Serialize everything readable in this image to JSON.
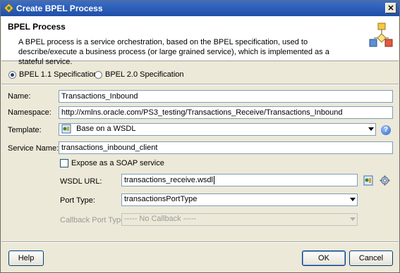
{
  "window": {
    "title": "Create BPEL Process",
    "close_glyph": "✕"
  },
  "header": {
    "title": "BPEL Process",
    "description": "A BPEL process is a service orchestration, based on the BPEL specification, used to describe/execute a business process (or large grained service), which is implemented as a stateful service."
  },
  "spec": {
    "option1": "BPEL 1.1 Specification",
    "option2": "BPEL 2.0 Specification",
    "selected": "BPEL 1.1 Specification"
  },
  "form": {
    "name_label": "Name:",
    "name_value": "Transactions_Inbound",
    "namespace_label": "Namespace:",
    "namespace_value": "http://xmlns.oracle.com/PS3_testing/Transactions_Receive/Transactions_Inbound",
    "template_label": "Template:",
    "template_value": "Base on a WSDL",
    "service_name_label": "Service Name:",
    "service_name_value": "transactions_inbound_client",
    "expose_soap_label": "Expose as a SOAP service",
    "expose_soap_checked": false,
    "wsdl_url_label": "WSDL URL:",
    "wsdl_url_value": "transactions_receive.wsdl",
    "port_type_label": "Port Type:",
    "port_type_value": "transactionsPortType",
    "callback_port_type_label": "Callback Port Type:",
    "callback_port_type_value": "----- No Callback -----"
  },
  "buttons": {
    "help": "Help",
    "ok": "OK",
    "cancel": "Cancel"
  },
  "icons": {
    "app": "bpel-app-icon",
    "flow": "process-flow-icon",
    "help": "help-icon",
    "wsdl_browse": "wsdl-browse-icon",
    "service_explorer": "service-explorer-icon"
  },
  "colors": {
    "titlebar": "#1f4fa8",
    "dialog_bg": "#ece9d8"
  }
}
